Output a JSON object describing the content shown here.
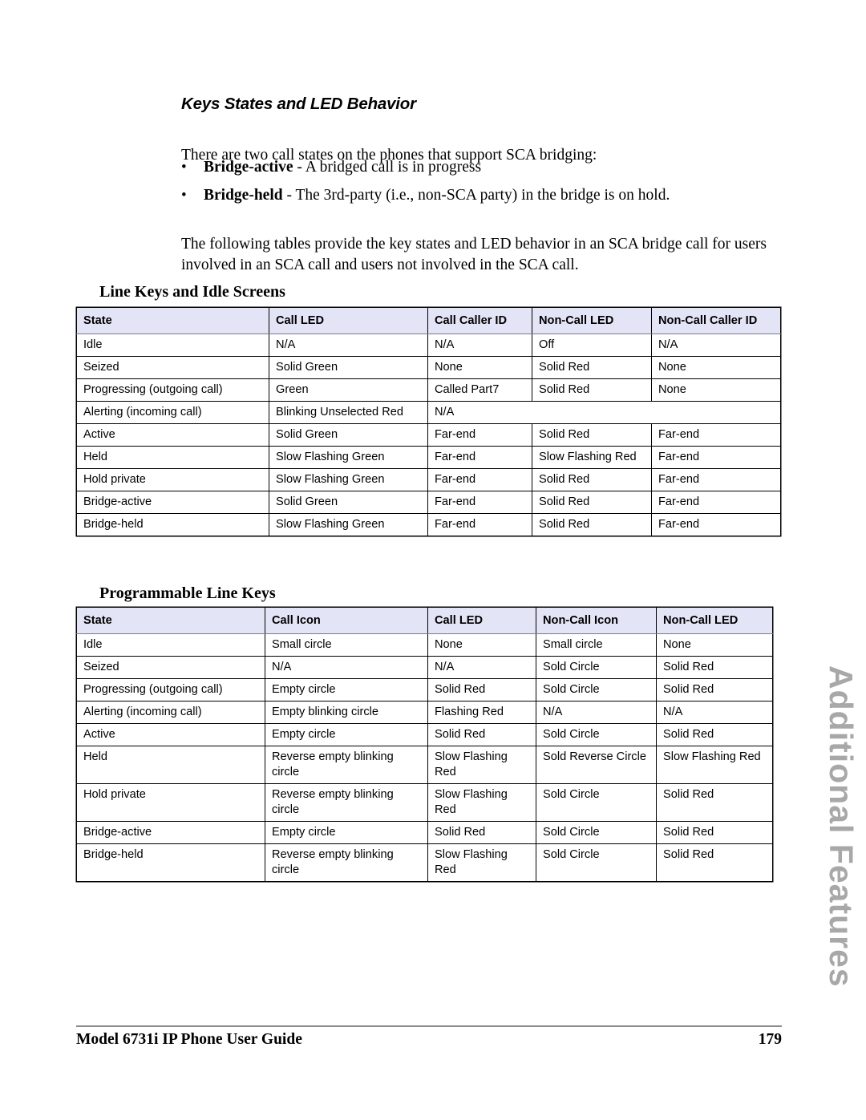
{
  "section": {
    "heading": "Keys States and LED Behavior",
    "intro": "There are two call states on the phones that support SCA bridging:",
    "bullets": [
      {
        "term": "Bridge-active",
        "desc": " - A bridged call is in progress"
      },
      {
        "term": "Bridge-held",
        "desc": " - The 3rd-party (i.e., non-SCA party) in the bridge is on hold."
      }
    ],
    "bullet_marker": "•",
    "paragraph": "The following tables provide the key states and LED behavior in an SCA bridge call for users involved in an SCA call and users not involved in the SCA call."
  },
  "table_line_keys": {
    "heading": "Line Keys and Idle Screens",
    "columns": [
      "State",
      "Call LED",
      "Call Caller ID",
      "Non-Call LED",
      "Non-Call Caller ID"
    ],
    "rows": [
      {
        "state": "Idle",
        "cells": [
          {
            "text": "N/A",
            "color": "black"
          },
          {
            "text": "N/A",
            "color": "black"
          },
          {
            "text": "Off",
            "color": "black"
          },
          {
            "text": "N/A",
            "color": "black"
          }
        ]
      },
      {
        "state": "Seized",
        "cells": [
          {
            "text": "Solid Green",
            "color": "green"
          },
          {
            "text": "None",
            "color": "black"
          },
          {
            "text": "Solid Red",
            "color": "red"
          },
          {
            "text": "None",
            "color": "black"
          }
        ]
      },
      {
        "state": "Progressing (outgoing call)",
        "cells": [
          {
            "text": "Green",
            "color": "green"
          },
          {
            "text": "Called Part7",
            "color": "black"
          },
          {
            "text": "Solid Red",
            "color": "red"
          },
          {
            "text": "None",
            "color": "black"
          }
        ]
      },
      {
        "state": "Alerting (incoming call)",
        "cells": [
          {
            "text": "Blinking Unselected Red",
            "color": "black"
          },
          {
            "text": "N/A",
            "color": "black",
            "colspan": 3
          }
        ]
      },
      {
        "state": "Active",
        "cells": [
          {
            "text": "Solid Green",
            "color": "green"
          },
          {
            "text": "Far-end",
            "color": "black"
          },
          {
            "text": "Solid Red",
            "color": "red"
          },
          {
            "text": "Far-end",
            "color": "black"
          }
        ]
      },
      {
        "state": "Held",
        "cells": [
          {
            "text": "Slow Flashing Green",
            "color": "green"
          },
          {
            "text": "Far-end",
            "color": "black"
          },
          {
            "text": "Slow Flashing Red",
            "color": "red"
          },
          {
            "text": "Far-end",
            "color": "black"
          }
        ]
      },
      {
        "state": "Hold private",
        "cells": [
          {
            "text": "Slow Flashing Green",
            "color": "green"
          },
          {
            "text": "Far-end",
            "color": "black"
          },
          {
            "text": "Solid Red",
            "color": "red"
          },
          {
            "text": "Far-end",
            "color": "black"
          }
        ]
      },
      {
        "state": "Bridge-active",
        "cells": [
          {
            "text": "Solid Green",
            "color": "green"
          },
          {
            "text": "Far-end",
            "color": "black"
          },
          {
            "text": "Solid Red",
            "color": "red"
          },
          {
            "text": "Far-end",
            "color": "black"
          }
        ]
      },
      {
        "state": "Bridge-held",
        "cells": [
          {
            "text": "Slow Flashing Green",
            "color": "green"
          },
          {
            "text": "Far-end",
            "color": "black"
          },
          {
            "text": "Solid Red",
            "color": "red"
          },
          {
            "text": "Far-end",
            "color": "black"
          }
        ]
      }
    ]
  },
  "table_programmable_keys": {
    "heading": "Programmable Line Keys",
    "columns": [
      "State",
      "Call Icon",
      "Call LED",
      "Non-Call Icon",
      "Non-Call LED"
    ],
    "rows": [
      {
        "state": "Idle",
        "cells": [
          {
            "text": "Small circle",
            "color": "black"
          },
          {
            "text": "None",
            "color": "black"
          },
          {
            "text": "Small circle",
            "color": "black"
          },
          {
            "text": "None",
            "color": "black"
          }
        ]
      },
      {
        "state": "Seized",
        "cells": [
          {
            "text": "N/A",
            "color": "black"
          },
          {
            "text": "N/A",
            "color": "black"
          },
          {
            "text": "Sold Circle",
            "color": "black"
          },
          {
            "text": "Solid Red",
            "color": "red"
          }
        ]
      },
      {
        "state": "Progressing (outgoing call)",
        "cells": [
          {
            "text": "Empty circle",
            "color": "black"
          },
          {
            "text": "Solid Red",
            "color": "red"
          },
          {
            "text": "Sold Circle",
            "color": "black"
          },
          {
            "text": "Solid Red",
            "color": "red"
          }
        ]
      },
      {
        "state": "Alerting (incoming call)",
        "cells": [
          {
            "text": "Empty blinking circle",
            "color": "black"
          },
          {
            "text": "Flashing Red",
            "color": "red"
          },
          {
            "text": "N/A",
            "color": "black"
          },
          {
            "text": "N/A",
            "color": "black"
          }
        ]
      },
      {
        "state": "Active",
        "cells": [
          {
            "text": "Empty circle",
            "color": "black"
          },
          {
            "text": "Solid Red",
            "color": "red"
          },
          {
            "text": "Sold Circle",
            "color": "black"
          },
          {
            "text": "Solid Red",
            "color": "red"
          }
        ]
      },
      {
        "state": "Held",
        "cells": [
          {
            "text": "Reverse empty blinking circle",
            "color": "black"
          },
          {
            "text": "Slow Flashing Red",
            "color": "red"
          },
          {
            "text": "Sold Reverse Circle",
            "color": "black"
          },
          {
            "text": "Slow Flashing Red",
            "color": "red"
          }
        ]
      },
      {
        "state": "Hold private",
        "cells": [
          {
            "text": "Reverse empty blinking circle",
            "color": "black"
          },
          {
            "text": "Slow Flashing Red",
            "color": "red"
          },
          {
            "text": "Sold Circle",
            "color": "black"
          },
          {
            "text": "Solid Red",
            "color": "red"
          }
        ]
      },
      {
        "state": "Bridge-active",
        "cells": [
          {
            "text": "Empty circle",
            "color": "black"
          },
          {
            "text": "Solid Red",
            "color": "red"
          },
          {
            "text": "Sold Circle",
            "color": "black"
          },
          {
            "text": "Solid Red",
            "color": "red"
          }
        ]
      },
      {
        "state": "Bridge-held",
        "cells": [
          {
            "text": "Reverse empty blinking circle",
            "color": "black"
          },
          {
            "text": "Slow Flashing Red",
            "color": "red"
          },
          {
            "text": "Sold Circle",
            "color": "black"
          },
          {
            "text": "Solid Red",
            "color": "red"
          }
        ]
      }
    ]
  },
  "side_tab": {
    "label": "Additional Features"
  },
  "footer": {
    "title": "Model 6731i IP Phone User Guide",
    "page_number": "179"
  },
  "colors": {
    "red": "#ff0000",
    "green": "#249a3c",
    "black": "#000000",
    "header_bg": "#e4e4f7",
    "side_tab": "#a8a8a8"
  }
}
